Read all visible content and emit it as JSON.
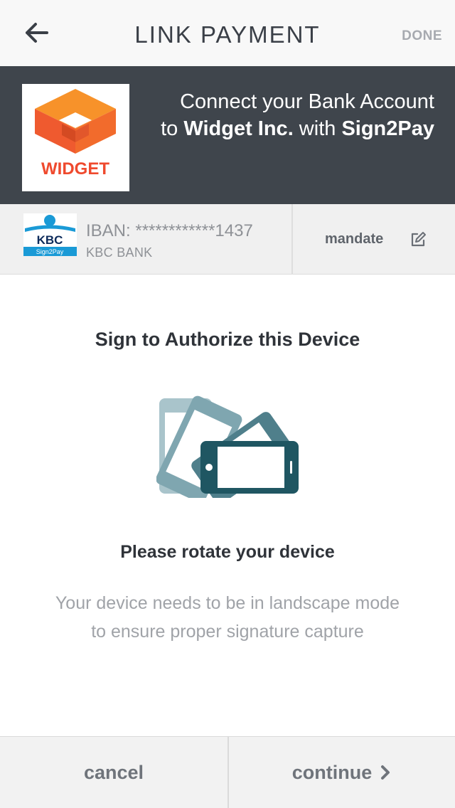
{
  "navbar": {
    "title": "LINK PAYMENT",
    "done_label": "DONE",
    "back_icon": "arrow-left-icon"
  },
  "banner": {
    "merchant_logo_text": "WIDGET",
    "line1": "Connect your Bank Account",
    "line2_prefix": "to ",
    "merchant_name": "Widget Inc.",
    "line2_middle": " with ",
    "service_name": "Sign2Pay",
    "background_color": "#3f454c"
  },
  "bank": {
    "logo_text": "KBC",
    "logo_subtext": "Sign2Pay",
    "iban": "IBAN: ************1437",
    "bank_name": "KBC BANK",
    "mandate_label": "mandate",
    "edit_icon": "edit-icon"
  },
  "content": {
    "heading": "Sign to Authorize this Device",
    "illustration": "rotate-device-icon",
    "subheading": "Please rotate your device",
    "description_line1": "Your device needs to be in landscape mode",
    "description_line2": "to ensure proper signature capture"
  },
  "footer": {
    "cancel_label": "cancel",
    "continue_label": "continue",
    "continue_icon": "chevron-right-icon"
  }
}
